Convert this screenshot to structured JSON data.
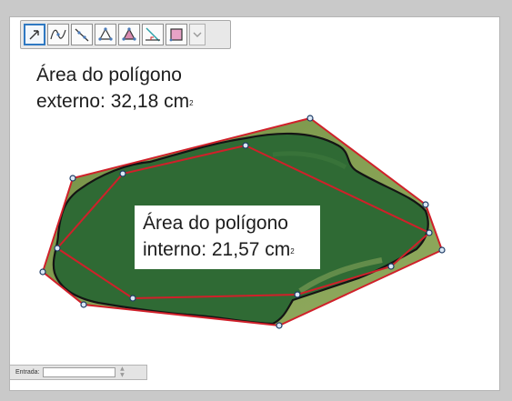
{
  "toolbar": {
    "tools": [
      {
        "name": "move-tool-icon",
        "active": true
      },
      {
        "name": "function-curve-tool-icon",
        "active": false
      },
      {
        "name": "line-through-points-tool-icon",
        "active": false
      },
      {
        "name": "polygon-tool-icon",
        "active": false
      },
      {
        "name": "filled-polygon-tool-icon",
        "active": false
      },
      {
        "name": "perpendicular-line-tool-icon",
        "active": false
      },
      {
        "name": "area-square-tool-icon",
        "active": false
      }
    ],
    "more_icon": "chevron-down-icon"
  },
  "labels": {
    "external_line1": "Área do polígono",
    "external_line2": "externo: 32,18 cm",
    "external_unit_sup": "2",
    "internal_line1": "Área do polígono",
    "internal_line2": "interno: 21,57 cm",
    "internal_unit_sup": "2"
  },
  "input_bar": {
    "label": "Entrada:",
    "value": ""
  },
  "colors": {
    "polygon_stroke": "#d0202a",
    "point_fill": "#dbe8f5",
    "point_stroke": "#1f3c66",
    "region_fill": "#2f6a34",
    "region_outline": "#141414",
    "active_tool_border": "#2f79c2"
  }
}
